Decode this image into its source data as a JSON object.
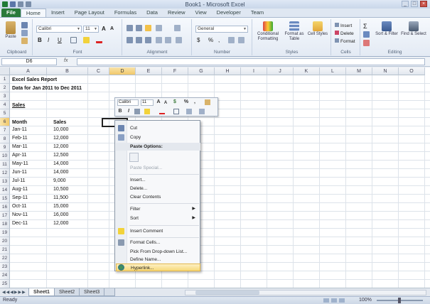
{
  "window": {
    "title": "Book1 - Microsoft Excel"
  },
  "ribbon_tabs": [
    "File",
    "Home",
    "Insert",
    "Page Layout",
    "Formulas",
    "Data",
    "Review",
    "View",
    "Developer",
    "Team"
  ],
  "ribbon": {
    "clipboard": {
      "paste": "Paste",
      "label": "Clipboard"
    },
    "font": {
      "name": "Calibri",
      "size": "11",
      "bold": "B",
      "italic": "I",
      "underline": "U",
      "label": "Font"
    },
    "alignment": {
      "label": "Alignment"
    },
    "number": {
      "format": "General",
      "dollar": "$",
      "percent": "%",
      "comma": ",",
      "label": "Number"
    },
    "styles": {
      "conditional": "Conditional Formatting",
      "format_table": "Format as Table",
      "cell_styles": "Cell Styles",
      "label": "Styles"
    },
    "cells": {
      "insert": "Insert",
      "delete": "Delete",
      "format": "Format",
      "label": "Cells"
    },
    "editing": {
      "sigma": "Σ",
      "sort": "Sort & Filter",
      "find": "Find & Select",
      "label": "Editing"
    }
  },
  "formula_bar": {
    "name_box": "D6",
    "fx": "fx",
    "value": ""
  },
  "columns": [
    "A",
    "B",
    "C",
    "D",
    "E",
    "F",
    "G",
    "H",
    "I",
    "J",
    "K",
    "L",
    "M",
    "N",
    "O"
  ],
  "rows": [
    "1",
    "2",
    "3",
    "4",
    "5",
    "6",
    "7",
    "8",
    "9",
    "10",
    "11",
    "12",
    "13",
    "14",
    "15",
    "16",
    "17",
    "18",
    "19",
    "20",
    "21",
    "22",
    "23",
    "24",
    "25"
  ],
  "cells": {
    "a1": "Excel Sales Report",
    "a2": "Data for Jan 2011 to Dec 2011",
    "a4": "Sales",
    "a6": "Month",
    "b6": "Sales",
    "months": [
      "Jan-11",
      "Feb-11",
      "Mar-11",
      "Apr-11",
      "May-11",
      "Jun-11",
      "Jul-11",
      "Aug-11",
      "Sep-11",
      "Oct-11",
      "Nov-11",
      "Dec-11"
    ],
    "sales": [
      "10,000",
      "12,000",
      "12,000",
      "12,500",
      "14,000",
      "14,000",
      "9,000",
      "10,500",
      "11,500",
      "15,000",
      "16,000",
      "12,000"
    ]
  },
  "mini_toolbar": {
    "font": "Calibri",
    "size": "11",
    "grow": "A",
    "shrink": "A",
    "dollar": "$",
    "percent": "%",
    "comma": ",",
    "bold": "B",
    "italic": "I"
  },
  "context_menu": {
    "cut": "Cut",
    "copy": "Copy",
    "paste_options": "Paste Options:",
    "paste_special": "Paste Special...",
    "insert": "Insert...",
    "delete": "Delete...",
    "clear": "Clear Contents",
    "filter": "Filter",
    "sort": "Sort",
    "insert_comment": "Insert Comment",
    "format_cells": "Format Cells...",
    "pick_list": "Pick From Drop-down List...",
    "define_name": "Define Name...",
    "hyperlink": "Hyperlink..."
  },
  "sheets": [
    "Sheet1",
    "Sheet2",
    "Sheet3"
  ],
  "status": {
    "ready": "Ready",
    "zoom": "100%"
  },
  "colors": {
    "file_tab": "#2a7a3a",
    "selection_header": "#f1c86a",
    "menu_highlight": "#f7d97a"
  }
}
